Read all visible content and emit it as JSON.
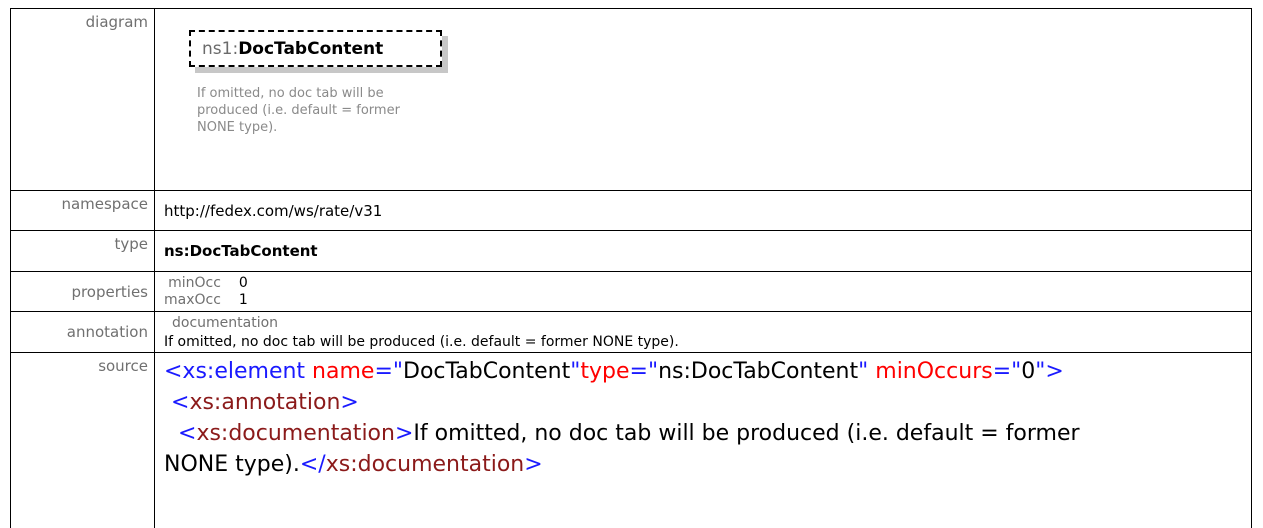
{
  "rows": {
    "diagram": {
      "label": "diagram"
    },
    "namespace": {
      "label": "namespace",
      "value": "http://fedex.com/ws/rate/v31"
    },
    "type": {
      "label": "type",
      "value": "ns:DocTabContent"
    },
    "properties": {
      "label": "properties",
      "items": [
        {
          "name": "minOcc",
          "value": "0"
        },
        {
          "name": "maxOcc",
          "value": "1"
        }
      ]
    },
    "annotation": {
      "label": "annotation",
      "heading": "documentation",
      "text": "If omitted, no doc tab will be produced (i.e. default = former NONE type)."
    },
    "source": {
      "label": "source"
    }
  },
  "diagram": {
    "prefix": "ns1:",
    "name": "DocTabContent",
    "documentation": "If omitted, no doc tab will be produced (i.e. default = former NONE type)."
  },
  "source": {
    "line1": {
      "open": "<xs:element",
      "attr1": " name",
      "eq1": "=\"",
      "val1": "DocTabContent",
      "q1": "\"",
      "attr2": "type",
      "eq2": "=\"",
      "val2": "ns:DocTabContent",
      "q2": "\"",
      "attr3": " minOccurs",
      "eq3": "=\"",
      "val3": "0",
      "close": "\">"
    },
    "line2": {
      "bracket_open": "<",
      "tag": "xs:annotation",
      "bracket_close": ">"
    },
    "line3": {
      "bracket_open": "<",
      "tag": "xs:documentation",
      "bracket_close": ">",
      "text": "If omitted, no doc tab will be produced (i.e. default = former"
    },
    "line4": {
      "text": "NONE type).",
      "bracket_open": "</",
      "tag": "xs:documentation",
      "bracket_close": ">"
    }
  },
  "colors": {
    "label_gray": "#707070",
    "markup_blue": "#1a1aff",
    "tag_maroon": "#8b1a1a",
    "attr_red": "#ff0000",
    "banner_purple": "#4b2590"
  }
}
